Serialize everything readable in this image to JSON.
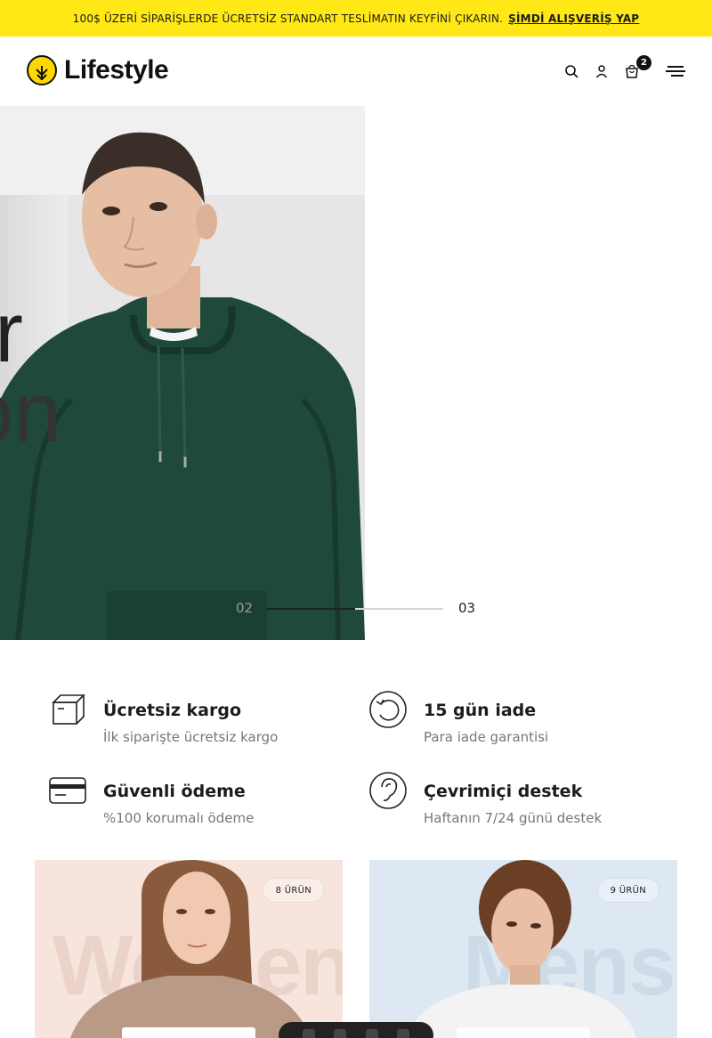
{
  "announcement": {
    "message": "100$ ÜZERİ SİPARİŞLERDE ÜCRETSİZ STANDART TESLİMATIN KEYFİNİ ÇIKARIN.",
    "cta": "ŞİMDİ ALIŞVERİŞ YAP"
  },
  "header": {
    "logo_text": "Lifestyle",
    "cart_count": "2",
    "icons": [
      "search-icon",
      "user-icon",
      "cart-icon",
      "menu-icon"
    ]
  },
  "hero": {
    "slide_prev": "02",
    "slide_next": "03",
    "overlay_letters": [
      "r",
      "on"
    ],
    "progress": 0.5
  },
  "features": [
    {
      "title": "Ücretsiz kargo",
      "desc": "İlk siparişte ücretsiz kargo",
      "icon": "box-icon"
    },
    {
      "title": "15 gün iade",
      "desc": "Para iade garantisi",
      "icon": "return-icon"
    },
    {
      "title": "Güvenli ödeme",
      "desc": "%100 korumalı ödeme",
      "icon": "credit-card-icon"
    },
    {
      "title": "Çevrimiçi destek",
      "desc": "Haftanın 7/24 günü destek",
      "icon": "support-ear-icon"
    }
  ],
  "categories": [
    {
      "watermark": "Women",
      "badge": "8 ÜRÜN",
      "bg": "#f7e5dd"
    },
    {
      "watermark": "Mens",
      "badge": "9 ÜRÜN",
      "bg": "#dde8f3"
    }
  ],
  "colors": {
    "accent": "#ffe815",
    "hoodie": "#1f4a3a",
    "text": "#111111",
    "muted": "#777777"
  }
}
